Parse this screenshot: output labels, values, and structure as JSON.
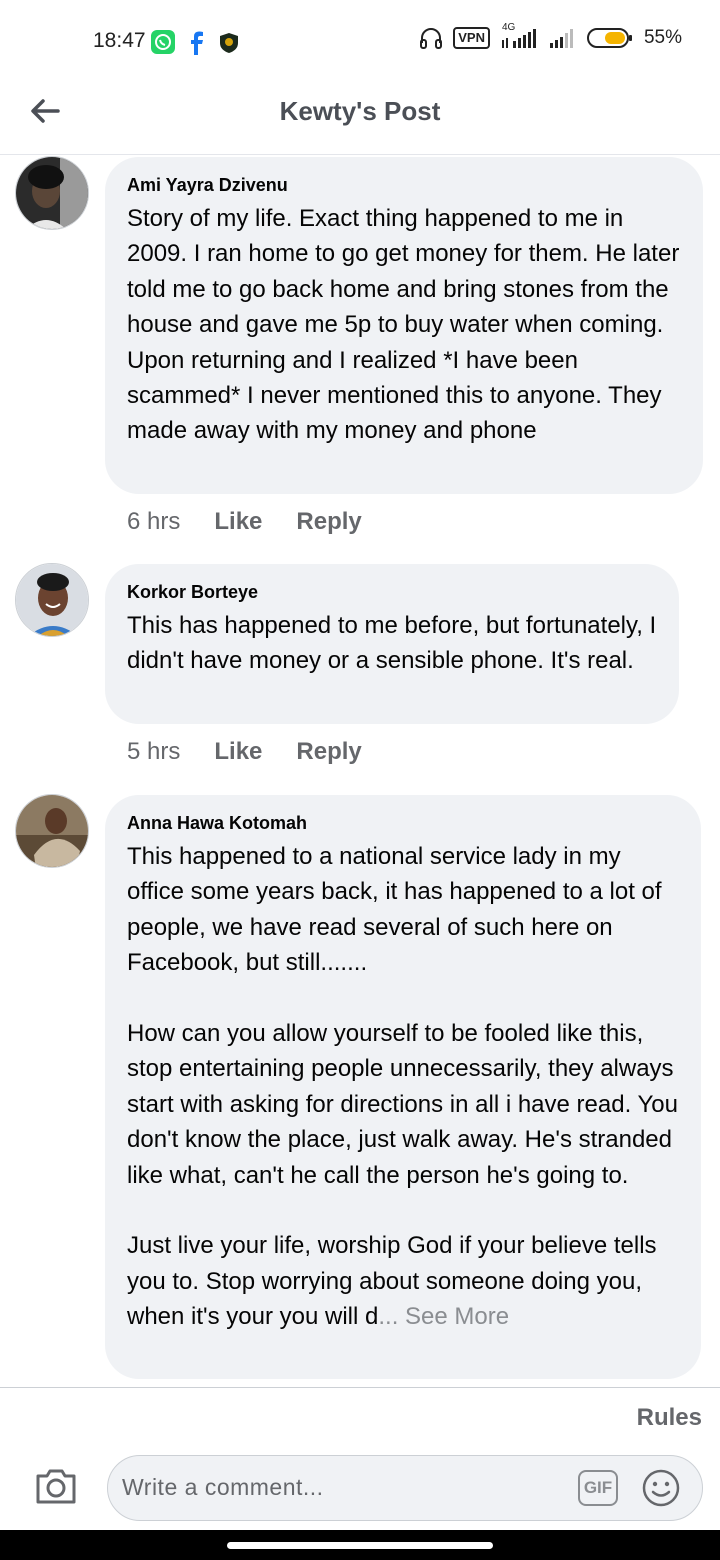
{
  "status_bar": {
    "time": "18:47",
    "vpn_label": "VPN",
    "network_label": "4G",
    "battery_percent": "55%",
    "icons": [
      "whatsapp-icon",
      "facebook-icon",
      "shield-app-icon",
      "headphones-icon",
      "vpn-icon",
      "signal-icon",
      "battery-icon"
    ]
  },
  "header": {
    "title": "Kewty's Post",
    "back_icon": "back-arrow-icon"
  },
  "comments": [
    {
      "author": "Ami Yayra Dzivenu",
      "text": "Story of my life. Exact thing happened to me in 2009. I ran home  to go get money for them. He later told me to go back home and bring stones from the house and gave me 5p to buy water when coming. Upon returning and I realized *I have been scammed* I never mentioned this to anyone. They made away with my money and phone",
      "time": "6 hrs",
      "like_label": "Like",
      "reply_label": "Reply"
    },
    {
      "author": "Korkor Borteye",
      "text": "This has happened to me before, but fortunately, I didn't have money or a sensible phone. It's real.",
      "time": "5 hrs",
      "like_label": "Like",
      "reply_label": "Reply"
    },
    {
      "author": "Anna Hawa Kotomah",
      "text": "This happened to a national service lady in my office some years back, it has happened to a lot of people, we have read several of such here on Facebook, but still.......\n\nHow can you allow yourself to be fooled like this, stop entertaining people unnecessarily, they always start with asking for directions in all i have read. You don't know the place, just walk away. He's stranded like what, can't he call the person he's going to.\n\nJust live your life, worship God if your believe tells you to. Stop worrying about someone doing you, when it's your you will d",
      "see_more": "... See More"
    }
  ],
  "footer": {
    "rules_label": "Rules",
    "comment_placeholder": "Write a comment...",
    "gif_label": "GIF",
    "camera_icon": "camera-icon",
    "emoji_icon": "emoji-icon"
  }
}
